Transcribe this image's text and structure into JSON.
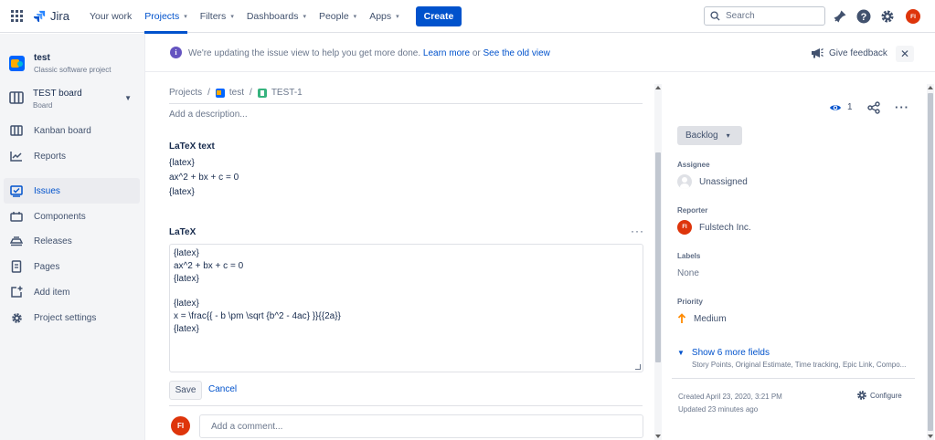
{
  "topnav": {
    "logo_text": "Jira",
    "items": [
      {
        "label": "Your work",
        "has_chevron": false,
        "active": false
      },
      {
        "label": "Projects",
        "has_chevron": true,
        "active": true
      },
      {
        "label": "Filters",
        "has_chevron": true,
        "active": false
      },
      {
        "label": "Dashboards",
        "has_chevron": true,
        "active": false
      },
      {
        "label": "People",
        "has_chevron": true,
        "active": false
      },
      {
        "label": "Apps",
        "has_chevron": true,
        "active": false
      }
    ],
    "create_label": "Create",
    "search_placeholder": "Search",
    "user_initials": "FI",
    "icons": [
      "app-switcher-icon",
      "notifications-icon",
      "help-icon",
      "settings-icon"
    ]
  },
  "sidebar": {
    "project_name": "test",
    "project_type": "Classic software project",
    "board_name": "TEST board",
    "board_sub": "Board",
    "items": [
      {
        "label": "Kanban board",
        "icon": "kanban-icon",
        "active": false
      },
      {
        "label": "Reports",
        "icon": "reports-icon",
        "active": false
      },
      {
        "label": "Issues",
        "icon": "issues-icon",
        "active": true
      },
      {
        "label": "Components",
        "icon": "components-icon",
        "active": false
      },
      {
        "label": "Releases",
        "icon": "releases-icon",
        "active": false
      },
      {
        "label": "Pages",
        "icon": "pages-icon",
        "active": false
      },
      {
        "label": "Add item",
        "icon": "add-item-icon",
        "active": false
      },
      {
        "label": "Project settings",
        "icon": "gear-icon",
        "active": false
      }
    ]
  },
  "banner": {
    "message": "We're updating the issue view to help you get more done.",
    "learn_more": "Learn more",
    "or": "or",
    "old_view": "See the old view",
    "feedback": "Give feedback"
  },
  "issue": {
    "breadcrumb": {
      "projects": "Projects",
      "project": "test",
      "issue_key": "TEST-1"
    },
    "description_placeholder": "Add a description...",
    "latex_text_title": "LaTeX text",
    "latex_text_lines": [
      "{latex}",
      "ax^2 + bx + c = 0",
      "{latex}"
    ],
    "latex_field_title": "LaTeX",
    "latex_field_value": "{latex}\nax^2 + bx + c = 0\n{latex}\n\n{latex}\nx = \\frac{{ - b \\pm \\sqrt {b^2 - 4ac} }}{{2a}}\n{latex}",
    "save_label": "Save",
    "cancel_label": "Cancel",
    "comment_avatar": "FI",
    "comment_placeholder": "Add a comment..."
  },
  "details": {
    "watchers": "1",
    "status": "Backlog",
    "assignee_label": "Assignee",
    "assignee_value": "Unassigned",
    "reporter_label": "Reporter",
    "reporter_initials": "FI",
    "reporter_value": "Fulstech Inc.",
    "labels_label": "Labels",
    "labels_value": "None",
    "priority_label": "Priority",
    "priority_value": "Medium",
    "priority_color": "#FF8B00",
    "show_more": "Show 6 more fields",
    "more_fields_list": "Story Points, Original Estimate, Time tracking, Epic Link, Compo...",
    "created": "Created April 23, 2020, 3:21 PM",
    "updated": "Updated 23 minutes ago",
    "configure": "Configure"
  },
  "colors": {
    "accent": "#0052CC",
    "avatar": "#DE350B",
    "sidebar_bg": "#F4F5F7"
  }
}
